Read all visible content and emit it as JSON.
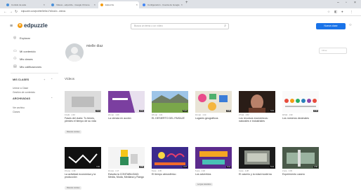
{
  "browser": {
    "tabs": [
      {
        "label": "Contido de aula",
        "fav": "#4a90d9"
      },
      {
        "label": "Videos - edpuzzle - Google Chrome",
        "fav": "#4a90d9"
      },
      {
        "label": "Edpuzzle",
        "fav": "#f39c12"
      },
      {
        "label": "Configuración - Cuenta de Google",
        "fav": "#4285f4"
      }
    ],
    "url": "edpuzzle.com/profile/5e9a17b2ea1b...videos"
  },
  "app": {
    "logo": "edpuzzle",
    "search_placeholder": "Busca un tema o un vídeo",
    "create_button": "Nueva clase"
  },
  "sidebar": {
    "top_items": [
      {
        "icon": "compass-icon",
        "label": "Explorar"
      },
      {
        "icon": "video-icon",
        "label": "Mi contenido"
      },
      {
        "icon": "people-icon",
        "label": "Mis clases"
      },
      {
        "icon": "gradebook-icon",
        "label": "Mis calificaciones"
      }
    ],
    "section1": {
      "title": "MIS CLASES",
      "items": [
        "Unirse a Clase",
        "Gestión de contenido"
      ]
    },
    "section2": {
      "title": "ARCHIVADAS",
      "items": [
        "Ver archivo",
        "Clases"
      ]
    }
  },
  "profile": {
    "name": "mielle diaz",
    "filter_placeholder": "Filtrar"
  },
  "videos_section": "Vídeos",
  "videos": [
    {
      "duration": "4:12",
      "meta": "13 abr · 1:43",
      "title": "Fases del duelo: Tu tienes, pierdes el tiempo de su vida",
      "tag": "Materias sociales"
    },
    {
      "duration": "2:51",
      "meta": "22 mar · 1:40",
      "title": "La ciencia en acción",
      "tag": ""
    },
    {
      "duration": "5:20",
      "meta": "18 mar · 1:21",
      "title": "EL DESIERTO DEL PAISAJE",
      "tag": ""
    },
    {
      "duration": "3:08",
      "meta": "10 mar · 1:14",
      "title": "Lugares geográficos",
      "tag": ""
    },
    {
      "duration": "6:02",
      "meta": "27 feb · 1:52",
      "title": "Los recursos económicos: naturales e industriales",
      "tag": ""
    },
    {
      "duration": "2:44",
      "meta": "18 feb · 1:30",
      "title": "Los números decimales",
      "tag": ""
    },
    {
      "duration": "3:30",
      "meta": "15 ene · 1:40",
      "title": "La actividad económica y la producción",
      "tag": "Materias sociales"
    },
    {
      "duration": "4:55",
      "meta": "10 ene · 1:17",
      "title": "Estudia la CONTABILIDAD: Media, Moda, Mediana y Rango",
      "tag": ""
    },
    {
      "duration": "2:27",
      "meta": "8 ene · 1:45",
      "title": "El tiempo atmosférico",
      "tag": ""
    },
    {
      "duration": "3:12",
      "meta": "6 ene · 1:32",
      "title": "Los adverbios",
      "tag": "Lengua castellana"
    },
    {
      "duration": "5:41",
      "meta": "4 ene · 1:28",
      "title": "El caserío y la edad moderna",
      "tag": ""
    },
    {
      "duration": "2:58",
      "meta": "2 ene · 1:33",
      "title": "Experimento casero",
      "tag": ""
    }
  ]
}
